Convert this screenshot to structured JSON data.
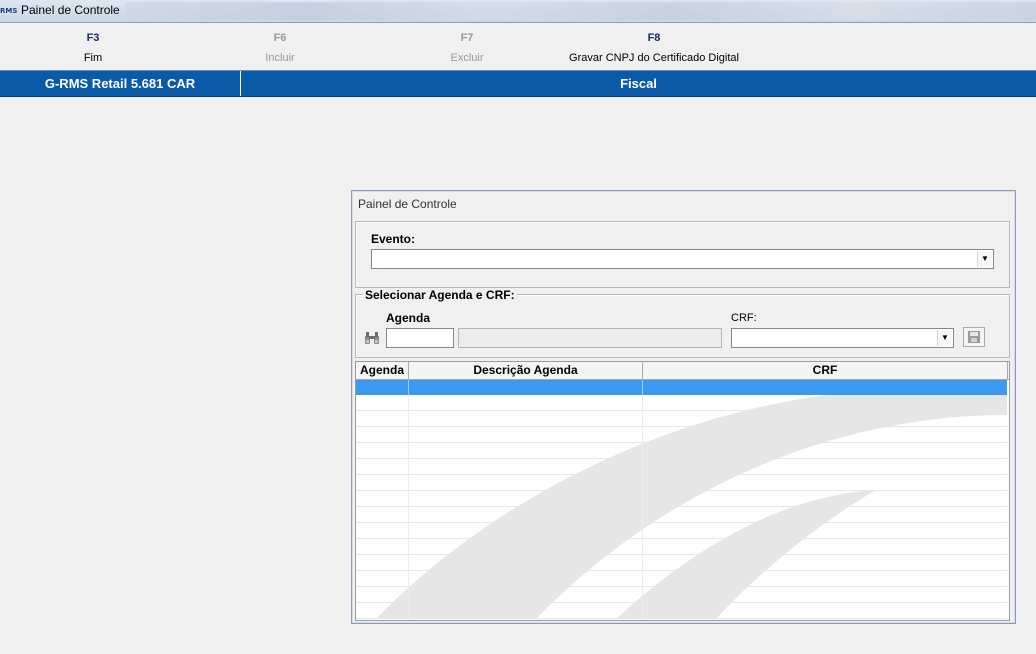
{
  "window": {
    "title": "Painel de Controle",
    "app_icon_text": "RMS"
  },
  "toolbar": {
    "keys": [
      {
        "key": "F3",
        "label": "Fim",
        "enabled": true
      },
      {
        "key": "F6",
        "label": "Incluir",
        "enabled": false
      },
      {
        "key": "F7",
        "label": "Excluir",
        "enabled": false
      },
      {
        "key": "F8",
        "label": "Gravar CNPJ do Certificado Digital",
        "enabled": true
      }
    ]
  },
  "header": {
    "system": "G-RMS Retail 5.681 CAR",
    "module": "Fiscal"
  },
  "dialog": {
    "title": "Painel de Controle",
    "evento": {
      "label": "Evento:",
      "value": ""
    },
    "selecionar": {
      "legend": "Selecionar Agenda e CRF:",
      "agenda_label": "Agenda",
      "agenda_value": "",
      "agenda_desc": "",
      "crf_label": "CRF:",
      "crf_value": ""
    },
    "grid": {
      "columns": [
        "Agenda",
        "Descrição Agenda",
        "CRF"
      ],
      "rows": [
        {
          "agenda": "",
          "descricao": "",
          "crf": ""
        }
      ]
    }
  },
  "colors": {
    "accent_bar": "#0a5aa8",
    "selection": "#3c99f0"
  }
}
